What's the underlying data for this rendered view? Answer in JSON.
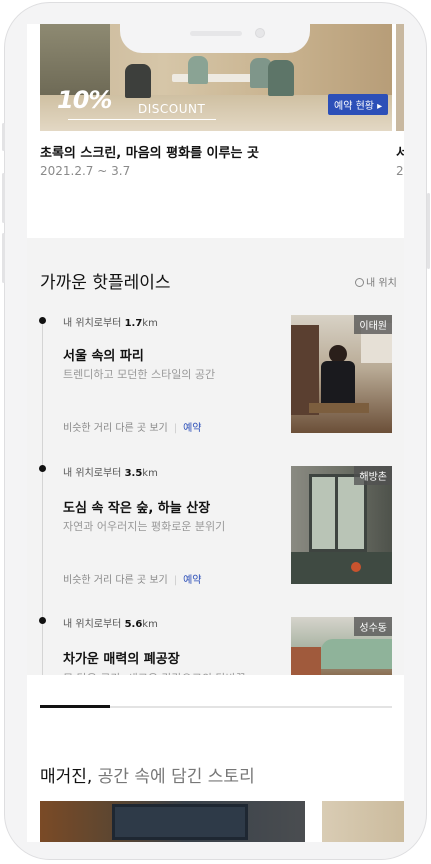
{
  "hero": {
    "discount_pct": "10%",
    "discount_label": "DISCOUNT",
    "reserve_label": "예약 현황 ▸",
    "title": "초록의 스크린, 마음의 평화를 이루는 곳",
    "date": "2021.2.7 ~ 3.7",
    "peek_title": "서",
    "peek_date": "2"
  },
  "nearby": {
    "title": "가까운 핫플레이스",
    "my_location": "내 위치",
    "dist_prefix": "내 위치로부터",
    "similar_label": "비슷한 거리 다른 곳 보기",
    "reserve_label": "예약",
    "places": [
      {
        "distance": "1.7",
        "unit": "km",
        "name": "서울 속의 파리",
        "desc": "트렌디하고 모던한 스타일의 공간",
        "tag": "이태원"
      },
      {
        "distance": "3.5",
        "unit": "km",
        "name": "도심 속 작은 숲, 하늘 산장",
        "desc": "자연과 어우러지는 평화로운 분위기",
        "tag": "해방촌"
      },
      {
        "distance": "5.6",
        "unit": "km",
        "name": "차가운 매력의 폐공장",
        "desc": "무 닿은 공간, 새로운 감각으로의 탈바꿈",
        "tag": "성수동"
      }
    ]
  },
  "magazine": {
    "title": "매거진,",
    "subtitle": " 공간 속에 담긴 스토리"
  },
  "progress": 0.2,
  "colors": {
    "accent": "#2c4fb8",
    "band": "#f3f3f3"
  }
}
